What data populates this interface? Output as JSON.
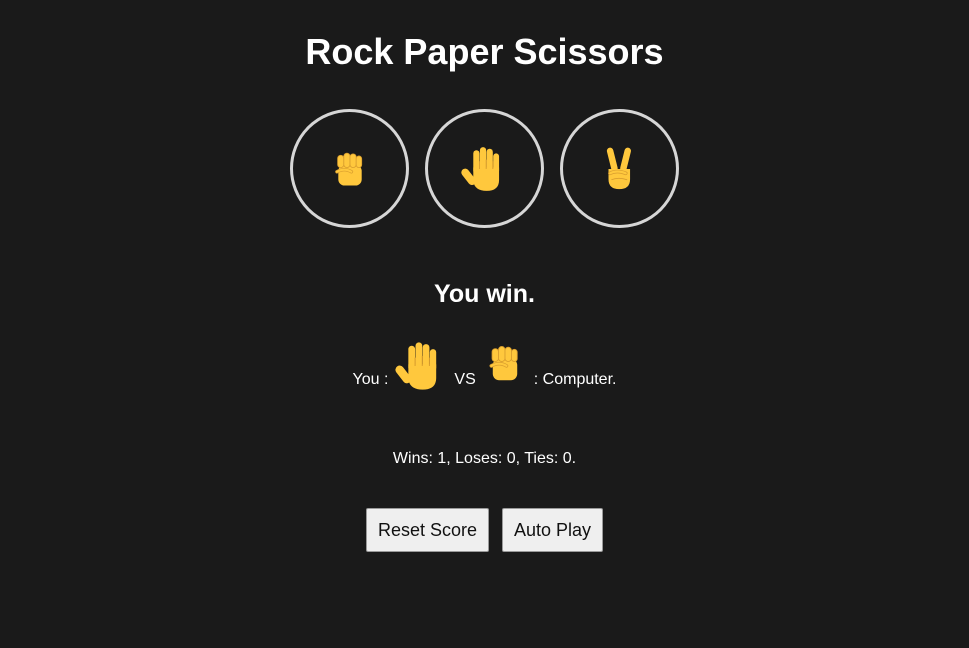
{
  "app": {
    "title": "Rock Paper Scissors"
  },
  "moves": [
    {
      "name": "rock",
      "icon": "raised-fist"
    },
    {
      "name": "paper",
      "icon": "raised-hand"
    },
    {
      "name": "scissors",
      "icon": "victory-hand"
    }
  ],
  "result": {
    "text": "You win."
  },
  "moves_played": {
    "you_label": "You :",
    "you_move_icon": "raised-hand",
    "vs_label": "VS",
    "computer_move_icon": "raised-fist",
    "computer_label": ": Computer."
  },
  "score": {
    "text": "Wins: 1, Loses: 0, Ties: 0."
  },
  "controls": {
    "reset_label": "Reset Score",
    "auto_play_label": "Auto Play"
  },
  "colors": {
    "background": "#1a1a1a",
    "text": "#ffffff",
    "circle_border": "#d6d6d6",
    "emoji_yellow": "#FFC83D",
    "emoji_shade": "#D99E2E",
    "button_bg": "#efefef"
  }
}
